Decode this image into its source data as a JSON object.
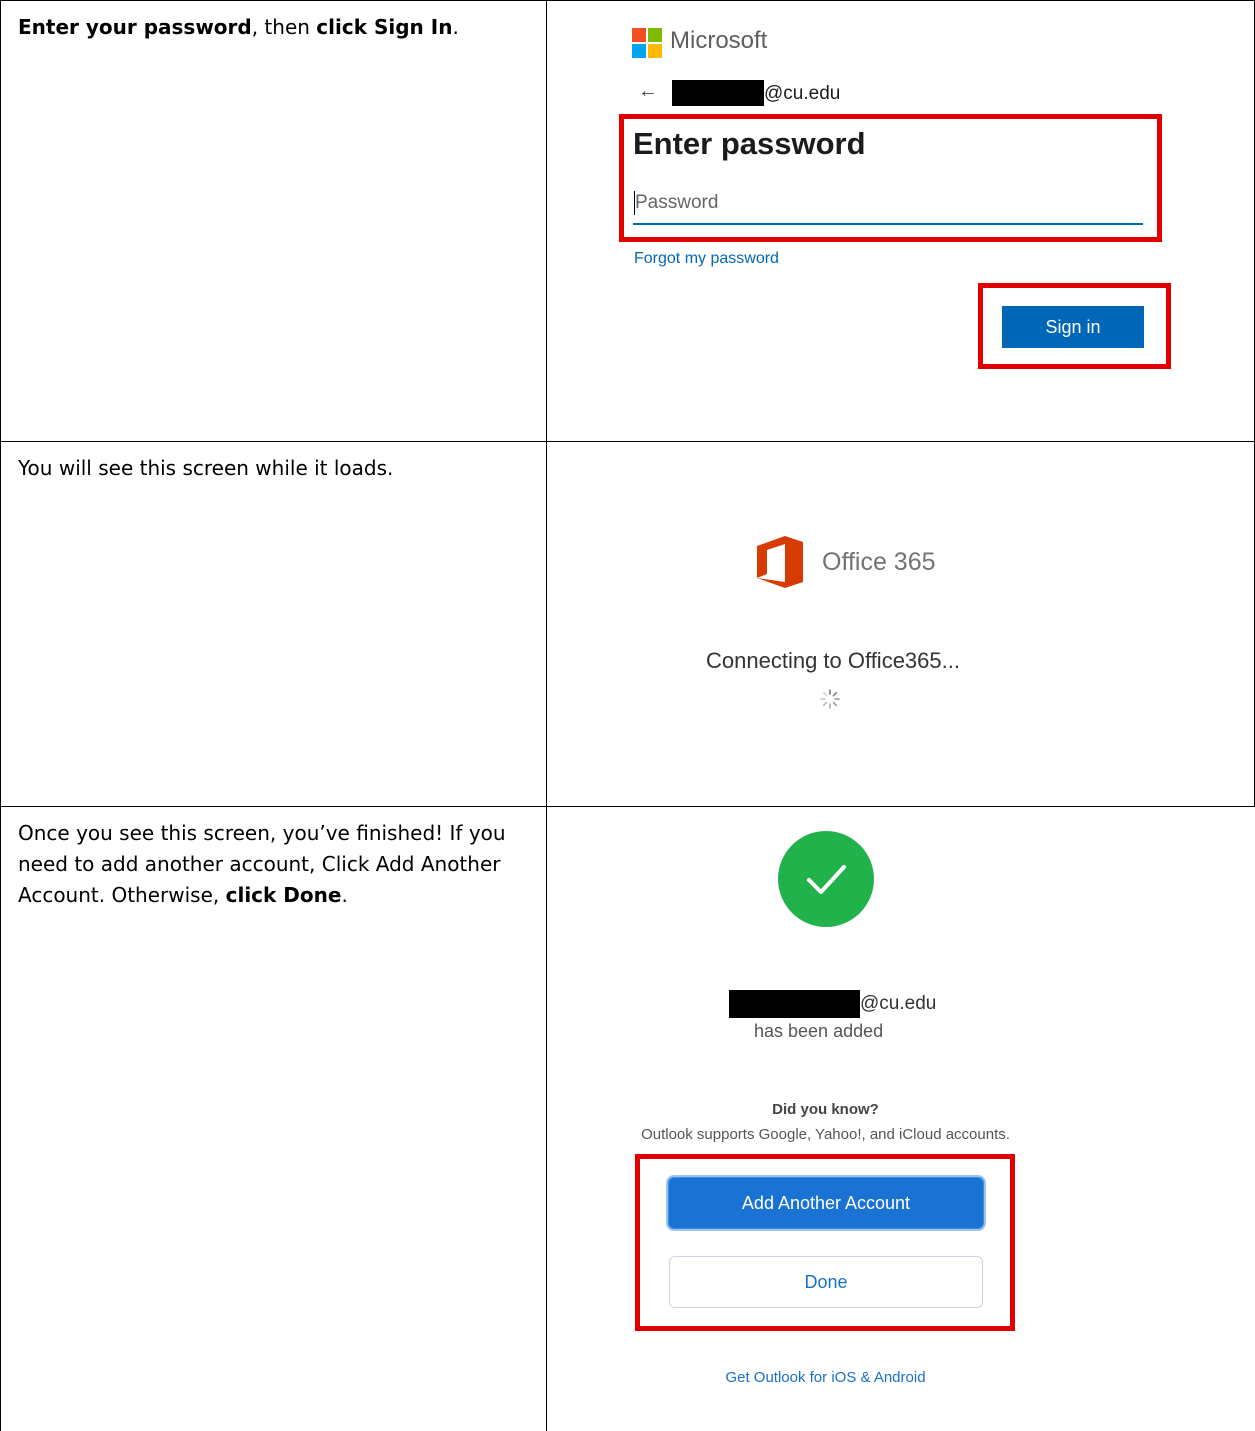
{
  "rows": [
    {
      "instruction_bold_1": "Enter your password",
      "instruction_text_1": ", then ",
      "instruction_bold_2": "click Sign In",
      "instruction_text_2": "."
    },
    {
      "instruction_text": "You will see this screen while it loads."
    },
    {
      "instruction_text_1": "Once you see this screen, you’ve finished! If you need to add another account, Click Add Another Account. Otherwise, ",
      "instruction_bold_1": "click Done",
      "instruction_text_2": "."
    }
  ],
  "signin": {
    "brand": "Microsoft",
    "back_arrow": "←",
    "email_suffix": "@cu.edu",
    "heading": "Enter password",
    "password_placeholder": "Password",
    "forgot_link": "Forgot my password",
    "signin_button": "Sign in",
    "logo_colors": [
      "#f25022",
      "#7fba00",
      "#00a4ef",
      "#ffb900"
    ],
    "accent": "#0067b8"
  },
  "loading": {
    "product_name": "Office 365",
    "status": "Connecting to Office365...",
    "logo_color": "#d83b01"
  },
  "added": {
    "email_suffix": "@cu.edu",
    "added_text": "has been added",
    "did_you_know": "Did you know?",
    "supports_text": "Outlook supports Google, Yahoo!, and iCloud accounts.",
    "add_button": "Add Another Account",
    "done_button": "Done",
    "get_outlook_link": "Get Outlook for iOS & Android",
    "check_color": "#21b24b"
  },
  "highlight_color": "#e00000"
}
